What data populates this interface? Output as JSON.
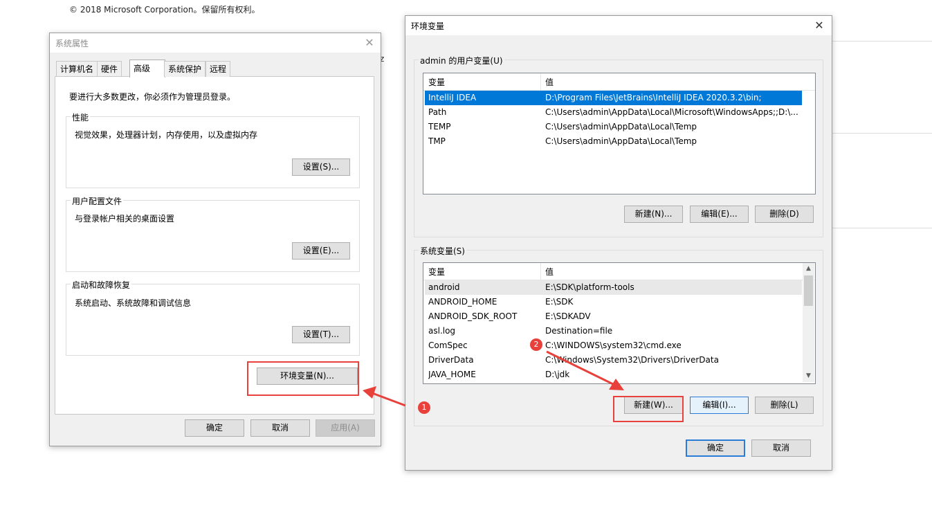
{
  "background": {
    "copyright": "© 2018 Microsoft Corporation。保留所有权利。",
    "stray_char": "z"
  },
  "sysprops": {
    "title": "系统属性",
    "tabs": [
      {
        "label": "计算机名",
        "active": false
      },
      {
        "label": "硬件",
        "active": false
      },
      {
        "label": "高级",
        "active": true
      },
      {
        "label": "系统保护",
        "active": false
      },
      {
        "label": "远程",
        "active": false
      }
    ],
    "admin_note": "要进行大多数更改，你必须作为管理员登录。",
    "performance": {
      "title": "性能",
      "desc": "视觉效果，处理器计划，内存使用，以及虚拟内存",
      "button": "设置(S)..."
    },
    "profile": {
      "title": "用户配置文件",
      "desc": "与登录帐户相关的桌面设置",
      "button": "设置(E)..."
    },
    "startup": {
      "title": "启动和故障恢复",
      "desc": "系统启动、系统故障和调试信息",
      "button": "设置(T)..."
    },
    "env_button": "环境变量(N)...",
    "ok": "确定",
    "cancel": "取消",
    "apply": "应用(A)"
  },
  "envvars": {
    "title": "环境变量",
    "user_group": "admin 的用户变量(U)",
    "columns": {
      "name": "变量",
      "value": "值"
    },
    "user_vars": [
      {
        "name": "IntelliJ IDEA",
        "value": "D:\\Program Files\\JetBrains\\IntelliJ IDEA 2020.3.2\\bin;"
      },
      {
        "name": "Path",
        "value": "C:\\Users\\admin\\AppData\\Local\\Microsoft\\WindowsApps;;D:\\..."
      },
      {
        "name": "TEMP",
        "value": "C:\\Users\\admin\\AppData\\Local\\Temp"
      },
      {
        "name": "TMP",
        "value": "C:\\Users\\admin\\AppData\\Local\\Temp"
      }
    ],
    "user_buttons": {
      "new": "新建(N)...",
      "edit": "编辑(E)...",
      "delete": "删除(D)"
    },
    "system_group": "系统变量(S)",
    "system_vars": [
      {
        "name": "android",
        "value": "E:\\SDK\\platform-tools"
      },
      {
        "name": "ANDROID_HOME",
        "value": "E:\\SDK"
      },
      {
        "name": "ANDROID_SDK_ROOT",
        "value": "E:\\SDKADV"
      },
      {
        "name": "asl.log",
        "value": "Destination=file"
      },
      {
        "name": "ComSpec",
        "value": "C:\\WINDOWS\\system32\\cmd.exe"
      },
      {
        "name": "DriverData",
        "value": "C:\\Windows\\System32\\Drivers\\DriverData"
      },
      {
        "name": "JAVA_HOME",
        "value": "D:\\jdk"
      }
    ],
    "system_buttons": {
      "new": "新建(W)...",
      "edit": "编辑(I)...",
      "delete": "删除(L)"
    },
    "ok": "确定",
    "cancel": "取消"
  },
  "annotations": {
    "step1": "1",
    "step2": "2",
    "color": "#e8413b"
  }
}
